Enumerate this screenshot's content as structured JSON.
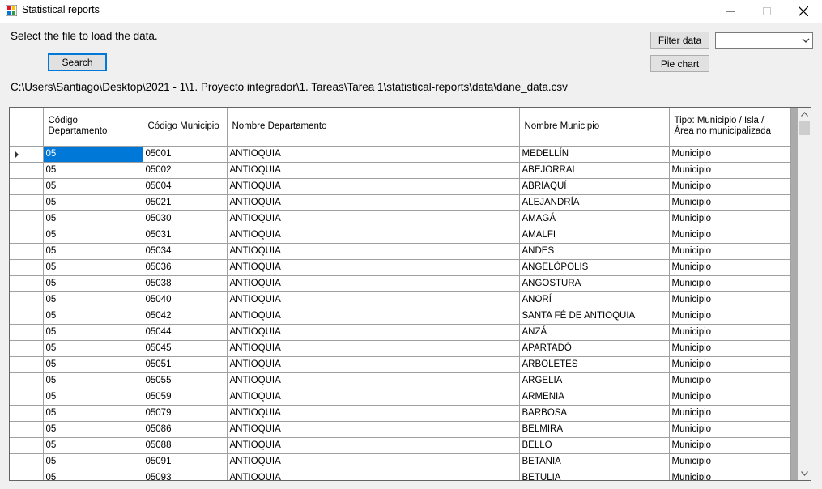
{
  "window": {
    "title": "Statistical reports"
  },
  "controls": {
    "prompt": "Select the file to load the data.",
    "search_label": "Search",
    "filter_label": "Filter data",
    "pie_label": "Pie chart",
    "combo_value": "",
    "file_path": "C:\\Users\\Santiago\\Desktop\\2021 - 1\\1. Proyecto integrador\\1. Tareas\\Tarea 1\\statistical-reports\\data\\dane_data.csv"
  },
  "grid": {
    "columns": [
      "Código Departamento",
      "Código Municipio",
      "Nombre Departamento",
      "Nombre Municipio",
      "Tipo: Municipio / Isla / Área no municipalizada"
    ],
    "rows": [
      [
        "05",
        "05001",
        "ANTIOQUIA",
        "MEDELLÍN",
        "Municipio"
      ],
      [
        "05",
        "05002",
        "ANTIOQUIA",
        "ABEJORRAL",
        "Municipio"
      ],
      [
        "05",
        "05004",
        "ANTIOQUIA",
        "ABRIAQUÍ",
        "Municipio"
      ],
      [
        "05",
        "05021",
        "ANTIOQUIA",
        "ALEJANDRÍA",
        "Municipio"
      ],
      [
        "05",
        "05030",
        "ANTIOQUIA",
        "AMAGÁ",
        "Municipio"
      ],
      [
        "05",
        "05031",
        "ANTIOQUIA",
        "AMALFI",
        "Municipio"
      ],
      [
        "05",
        "05034",
        "ANTIOQUIA",
        "ANDES",
        "Municipio"
      ],
      [
        "05",
        "05036",
        "ANTIOQUIA",
        "ANGELÓPOLIS",
        "Municipio"
      ],
      [
        "05",
        "05038",
        "ANTIOQUIA",
        "ANGOSTURA",
        "Municipio"
      ],
      [
        "05",
        "05040",
        "ANTIOQUIA",
        "ANORÍ",
        "Municipio"
      ],
      [
        "05",
        "05042",
        "ANTIOQUIA",
        "SANTA FÉ DE ANTIOQUIA",
        "Municipio"
      ],
      [
        "05",
        "05044",
        "ANTIOQUIA",
        "ANZÁ",
        "Municipio"
      ],
      [
        "05",
        "05045",
        "ANTIOQUIA",
        "APARTADÓ",
        "Municipio"
      ],
      [
        "05",
        "05051",
        "ANTIOQUIA",
        "ARBOLETES",
        "Municipio"
      ],
      [
        "05",
        "05055",
        "ANTIOQUIA",
        "ARGELIA",
        "Municipio"
      ],
      [
        "05",
        "05059",
        "ANTIOQUIA",
        "ARMENIA",
        "Municipio"
      ],
      [
        "05",
        "05079",
        "ANTIOQUIA",
        "BARBOSA",
        "Municipio"
      ],
      [
        "05",
        "05086",
        "ANTIOQUIA",
        "BELMIRA",
        "Municipio"
      ],
      [
        "05",
        "05088",
        "ANTIOQUIA",
        "BELLO",
        "Municipio"
      ],
      [
        "05",
        "05091",
        "ANTIOQUIA",
        "BETANIA",
        "Municipio"
      ],
      [
        "05",
        "05093",
        "ANTIOQUIA",
        "BETULIA",
        "Municipio"
      ]
    ]
  },
  "colors": {
    "selection": "#0078d7",
    "accent_border": "#0078d7"
  },
  "icons": {
    "app": "app-icon",
    "minimize": "minimize-icon",
    "maximize": "maximize-icon",
    "close": "close-icon",
    "dropdown": "chevron-down-icon",
    "row_pointer": "row-pointer-icon",
    "scroll_up": "scroll-up-icon",
    "scroll_down": "scroll-down-icon"
  }
}
